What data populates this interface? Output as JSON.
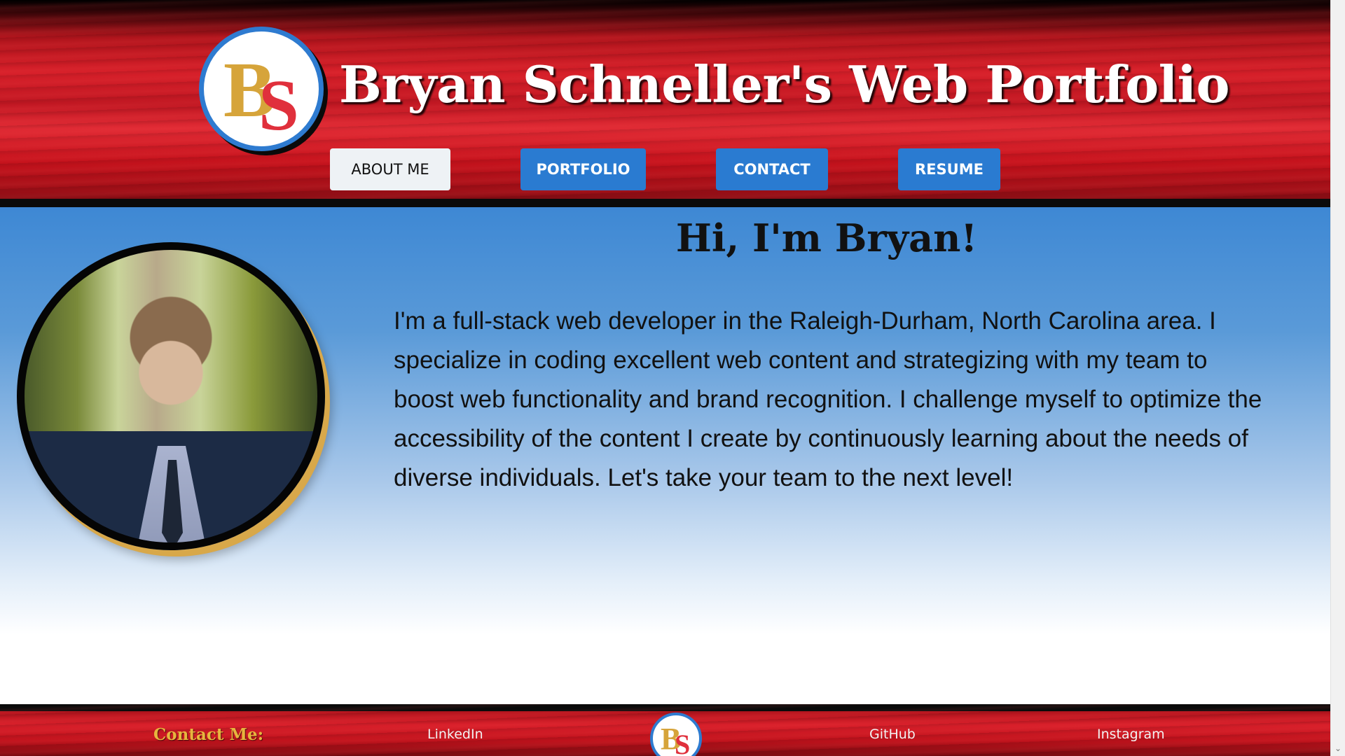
{
  "header": {
    "title": "Bryan Schneller's Web Portfolio",
    "logo_letters": [
      "B",
      "S"
    ],
    "nav": {
      "about": "ABOUT ME",
      "portfolio": "PORTFOLIO",
      "contact": "CONTACT",
      "resume": "RESUME"
    }
  },
  "main": {
    "greeting": "Hi, I'm Bryan!",
    "intro": "I'm a full-stack web developer in the Raleigh-Durham, North Carolina area. I specialize in coding excellent web content and strategizing with my team to boost web functionality and brand recognition. I challenge myself to optimize the accessibility of the content I create by continuously learning about the needs of diverse individuals. Let's take your team to the next level!"
  },
  "footer": {
    "contact_label": "Contact Me:",
    "links": {
      "linkedin": "LinkedIn",
      "github": "GitHub",
      "instagram": "Instagram"
    },
    "logo_letters": [
      "B",
      "S"
    ]
  },
  "colors": {
    "accent_blue": "#2a7bd1",
    "brand_red": "#d61f29",
    "gold": "#d6a43a"
  },
  "scrollbar": {
    "down_arrow": "⌄"
  }
}
